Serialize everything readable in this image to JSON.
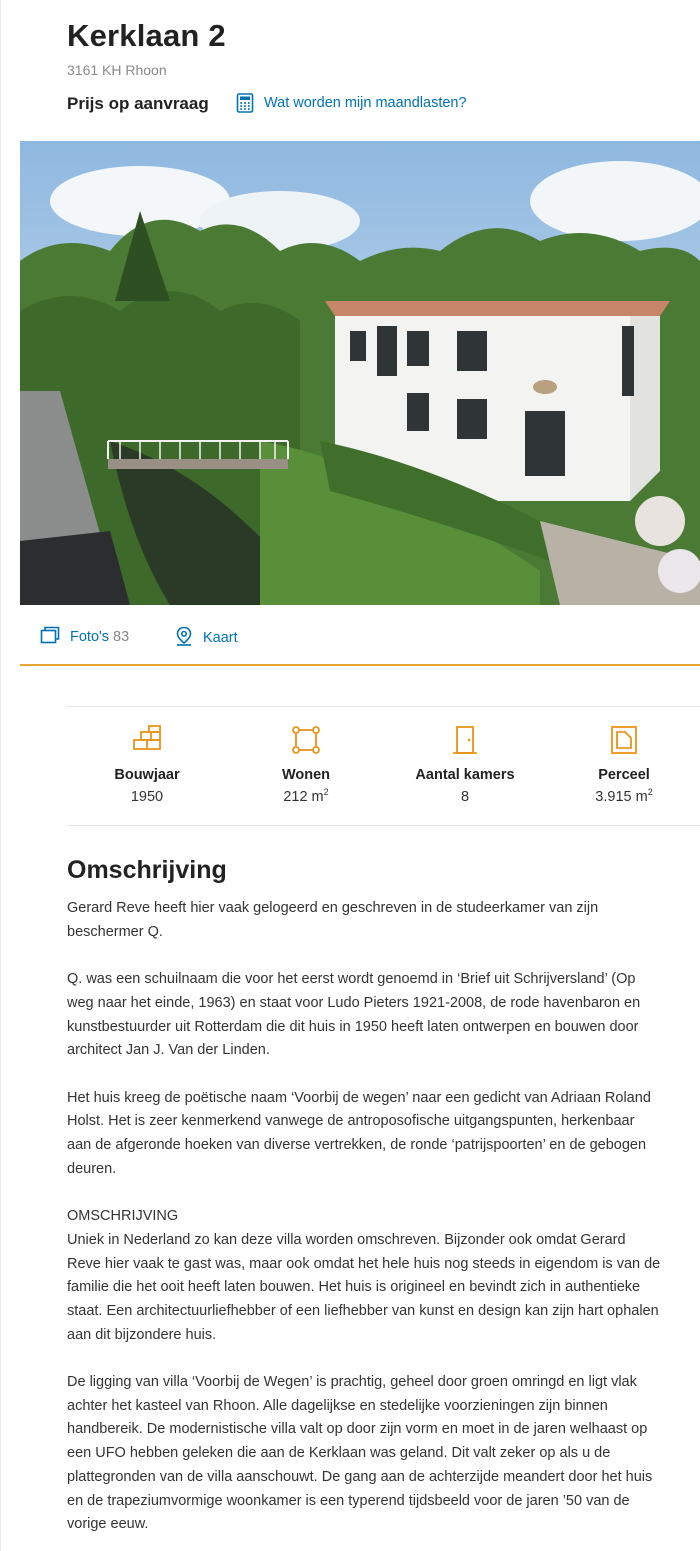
{
  "listing": {
    "address": "Kerklaan 2",
    "postal_city": "3161 KH Rhoon",
    "price": "Prijs op aanvraag",
    "mortgage_link": "Wat worden mijn maandlasten?"
  },
  "media": {
    "photos_label": "Foto's",
    "photos_count": "83",
    "map_label": "Kaart"
  },
  "features": [
    {
      "label": "Bouwjaar",
      "value": "1950",
      "unit": "",
      "icon": "building-year-icon"
    },
    {
      "label": "Wonen",
      "value": "212 m",
      "unit": "2",
      "icon": "living-area-icon"
    },
    {
      "label": "Aantal kamers",
      "value": "8",
      "unit": "",
      "icon": "door-icon"
    },
    {
      "label": "Perceel",
      "value": "3.915 m",
      "unit": "2",
      "icon": "plot-icon"
    }
  ],
  "description": {
    "heading": "Omschrijving",
    "text": "Gerard Reve heeft hier vaak gelogeerd en geschreven in de studeerkamer van zijn\nbeschermer Q.\n\nQ. was een schuilnaam die voor het eerst wordt genoemd in ‘Brief uit Schrijversland’ (Op\nweg naar het einde, 1963) en staat voor Ludo Pieters 1921-2008, de rode havenbaron en\nkunstbestuurder uit Rotterdam die dit huis in 1950 heeft laten ontwerpen en bouwen door\narchitect Jan J. Van der Linden.\n\nHet huis kreeg de poëtische naam ‘Voorbij de wegen’ naar een gedicht van Adriaan Roland\nHolst. Het is zeer kenmerkend vanwege de antroposofische uitgangspunten, herkenbaar\naan de afgeronde hoeken van diverse vertrekken, de ronde ‘patrijspoorten’ en de gebogen\ndeuren.\n\nOMSCHRIJVING\nUniek in Nederland zo kan deze villa worden omschreven. Bijzonder ook omdat Gerard\nReve hier vaak te gast was, maar ook omdat het hele huis nog steeds in eigendom is van de\nfamilie die het ooit heeft laten bouwen. Het huis is origineel en bevindt zich in authentieke\nstaat. Een architectuurliefhebber of een liefhebber van kunst en design kan zijn hart ophalen\naan dit bijzondere huis.\n\nDe ligging van villa ‘Voorbij de Wegen’ is prachtig, geheel door groen omringd en ligt vlak\nachter het kasteel van Rhoon. Alle dagelijkse en stedelijke voorzieningen zijn binnen\nhandbereik. De modernistische villa valt op door zijn vorm en moet in de jaren welhaast op\neen UFO hebben geleken die aan de Kerklaan was geland. Dit valt zeker op als u de\nplattegronden van de villa aanschouwt. De gang aan de achterzijde meandert door het huis\nen de trapeziumvormige woonkamer is een typerend tijdsbeeld voor de jaren ’50 van de\nvorige eeuw."
  },
  "colors": {
    "link": "#0071b3",
    "accent": "#e5a536",
    "icon": "#e8941a"
  }
}
